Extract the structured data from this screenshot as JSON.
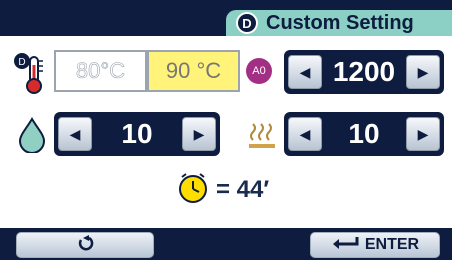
{
  "header": {
    "mode_icon_letter": "D",
    "title": "Custom Setting"
  },
  "temperature": {
    "options": [
      "80°C",
      "90 °C"
    ],
    "selected_index": 1
  },
  "ao_setting": {
    "badge": "A0",
    "value": "1200"
  },
  "water_setting": {
    "value": "10"
  },
  "heat_setting": {
    "value": "10"
  },
  "timer": {
    "text": "= 44′"
  },
  "footer": {
    "enter_label": "ENTER"
  },
  "colors": {
    "navy": "#0e1d3f",
    "mode_bg": "#8ccfc4",
    "selected_temp": "#fff37a",
    "badge": "#a32f85",
    "timer_icon": "#ffdd00"
  },
  "icons": [
    "thermometer-icon",
    "water-drop-icon",
    "heat-icon",
    "timer-icon",
    "back-icon",
    "enter-icon"
  ]
}
